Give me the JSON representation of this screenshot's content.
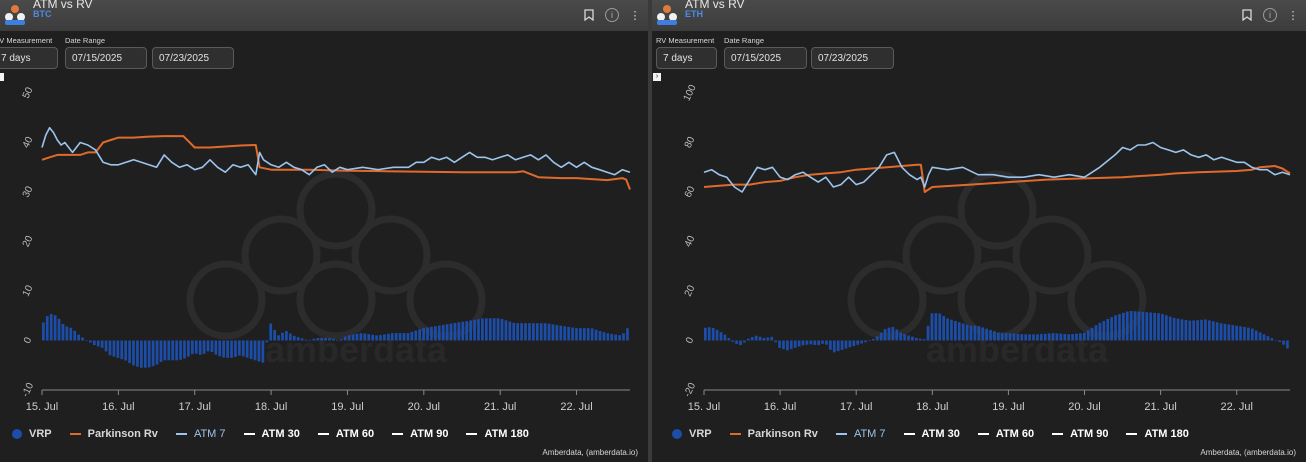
{
  "panels": [
    {
      "title": "ATM vs RV",
      "subtitle": "BTC",
      "controls": {
        "rv_label": "RV Measurement",
        "rv_value": "7 days",
        "date_label": "Date Range",
        "date_start": "07/15/2025",
        "date_end": "07/23/2025"
      },
      "watermark": "amberdata",
      "legend": [
        {
          "name": "VRP",
          "kind": "dot"
        },
        {
          "name": "Parkinson Rv",
          "kind": "line"
        },
        {
          "name": "ATM 7",
          "kind": "line"
        },
        {
          "name": "ATM 30",
          "kind": "line"
        },
        {
          "name": "ATM 60",
          "kind": "line"
        },
        {
          "name": "ATM 90",
          "kind": "line"
        },
        {
          "name": "ATM 180",
          "kind": "line"
        }
      ],
      "credit": "Amberdata, (amberdata.io)"
    },
    {
      "title": "ATM vs RV",
      "subtitle": "ETH",
      "controls": {
        "rv_label": "RV Measurement",
        "rv_value": "7 days",
        "date_label": "Date Range",
        "date_start": "07/15/2025",
        "date_end": "07/23/2025"
      },
      "watermark": "amberdata",
      "legend": [
        {
          "name": "VRP",
          "kind": "dot"
        },
        {
          "name": "Parkinson Rv",
          "kind": "line"
        },
        {
          "name": "ATM 7",
          "kind": "line"
        },
        {
          "name": "ATM 30",
          "kind": "line"
        },
        {
          "name": "ATM 60",
          "kind": "line"
        },
        {
          "name": "ATM 90",
          "kind": "line"
        },
        {
          "name": "ATM 180",
          "kind": "line"
        }
      ],
      "credit": "Amberdata, (amberdata.io)"
    }
  ],
  "colors": {
    "vrp": "#1c4da8",
    "parkinson": "#e06a2b",
    "atm7": "#9cc4ec",
    "atm_other": "#ffffff"
  },
  "chart_data": [
    {
      "type": "line",
      "asset": "BTC",
      "x_ticks": [
        "15. Jul",
        "16. Jul",
        "17. Jul",
        "18. Jul",
        "19. Jul",
        "20. Jul",
        "21. Jul",
        "22. Jul"
      ],
      "x_range_days": [
        15.0,
        22.7
      ],
      "ylim": [
        -10,
        50
      ],
      "y_ticks": [
        -10,
        0,
        10,
        20,
        30,
        40,
        50
      ],
      "grid": false,
      "legend_position": "bottom-left",
      "series": [
        {
          "name": "ATM 7",
          "x": [
            15.0,
            15.05,
            15.1,
            15.15,
            15.2,
            15.25,
            15.3,
            15.35,
            15.4,
            15.5,
            15.6,
            15.7,
            15.8,
            15.9,
            16.0,
            16.1,
            16.2,
            16.3,
            16.4,
            16.5,
            16.6,
            16.7,
            16.8,
            16.9,
            17.0,
            17.1,
            17.2,
            17.3,
            17.4,
            17.5,
            17.6,
            17.7,
            17.8,
            17.85,
            17.9,
            17.95,
            18.0,
            18.1,
            18.2,
            18.3,
            18.4,
            18.5,
            18.6,
            18.7,
            18.8,
            18.9,
            19.0,
            19.2,
            19.4,
            19.6,
            19.8,
            19.9,
            20.0,
            20.1,
            20.2,
            20.3,
            20.4,
            20.5,
            20.6,
            20.7,
            20.8,
            20.9,
            21.0,
            21.1,
            21.2,
            21.3,
            21.4,
            21.5,
            21.6,
            21.7,
            21.8,
            21.9,
            22.0,
            22.1,
            22.2,
            22.3,
            22.4,
            22.5,
            22.6,
            22.7
          ],
          "values": [
            39,
            41.5,
            43,
            42,
            40.5,
            39.5,
            40,
            39,
            38,
            40,
            39.5,
            38.5,
            36,
            35.5,
            35.5,
            36,
            36.5,
            36,
            35.5,
            35,
            37.5,
            36,
            35,
            35.5,
            34.5,
            35,
            36.5,
            35,
            34,
            35.5,
            35,
            35.5,
            33.5,
            38,
            36.5,
            36,
            35.5,
            35,
            36,
            35,
            34.5,
            33.5,
            35,
            35.5,
            34,
            35,
            34.5,
            35,
            34.5,
            35,
            35,
            36,
            36,
            37,
            36.5,
            37,
            36,
            37,
            38,
            37,
            37,
            36.5,
            37,
            37.5,
            36.5,
            37,
            37.5,
            36.5,
            37.5,
            36,
            35,
            36,
            35,
            36,
            35,
            34.5,
            34,
            33.5,
            34.5,
            34
          ]
        },
        {
          "name": "Parkinson Rv",
          "x": [
            15.0,
            15.1,
            15.2,
            15.3,
            15.4,
            15.5,
            15.6,
            15.7,
            15.8,
            15.9,
            16.0,
            16.2,
            16.4,
            16.6,
            16.8,
            16.85,
            17.0,
            17.2,
            17.4,
            17.6,
            17.8,
            17.85,
            18.0,
            18.5,
            19.0,
            19.5,
            20.0,
            20.5,
            21.0,
            21.2,
            21.3,
            21.5,
            21.8,
            22.0,
            22.2,
            22.4,
            22.6,
            22.65,
            22.7
          ],
          "values": [
            36.5,
            37,
            37.5,
            37.5,
            37.5,
            37.5,
            38,
            38,
            40,
            40.5,
            41,
            41,
            41.2,
            41.3,
            41.3,
            41.3,
            39,
            39,
            39.2,
            39.4,
            39.5,
            35,
            34.5,
            34.5,
            34.3,
            34.2,
            34.1,
            34,
            34,
            34,
            34.2,
            33,
            32.8,
            32.8,
            32.6,
            32.4,
            32.8,
            32.5,
            30.5
          ]
        },
        {
          "name": "VRP",
          "x": [
            15.0,
            15.1,
            15.2,
            15.3,
            15.4,
            15.5,
            15.6,
            15.7,
            15.8,
            15.9,
            16.0,
            16.1,
            16.2,
            16.3,
            16.4,
            16.5,
            16.6,
            16.7,
            16.8,
            16.9,
            17.0,
            17.1,
            17.2,
            17.3,
            17.4,
            17.5,
            17.6,
            17.7,
            17.8,
            17.9,
            18.0,
            18.1,
            18.2,
            18.3,
            18.4,
            18.5,
            18.6,
            18.7,
            18.8,
            18.9,
            19.0,
            19.2,
            19.4,
            19.6,
            19.8,
            20.0,
            20.2,
            20.4,
            20.6,
            20.8,
            21.0,
            21.2,
            21.4,
            21.6,
            21.8,
            22.0,
            22.2,
            22.4,
            22.6,
            22.7
          ],
          "values": [
            3,
            5.5,
            5,
            3,
            2.5,
            1,
            0,
            -1,
            -1.5,
            -3,
            -3.5,
            -4,
            -5,
            -5.5,
            -5.5,
            -5,
            -4,
            -4,
            -4,
            -3.5,
            -2.5,
            -3,
            -2,
            -3,
            -3.5,
            -3.5,
            -3,
            -3.5,
            -4,
            -4.5,
            3.5,
            1,
            2,
            1,
            0.5,
            0,
            0.5,
            0.5,
            0.5,
            0,
            1,
            1.5,
            1,
            1.5,
            1.5,
            2.5,
            3,
            3.5,
            4,
            4.5,
            4.5,
            3.5,
            3.5,
            3.5,
            3,
            2.5,
            2.5,
            1.5,
            1,
            3
          ]
        }
      ]
    },
    {
      "type": "line",
      "asset": "ETH",
      "x_ticks": [
        "15. Jul",
        "16. Jul",
        "17. Jul",
        "18. Jul",
        "19. Jul",
        "20. Jul",
        "21. Jul",
        "22. Jul"
      ],
      "x_range_days": [
        15.0,
        22.7
      ],
      "ylim": [
        -20,
        100
      ],
      "y_ticks": [
        -20,
        0,
        20,
        40,
        60,
        80,
        100
      ],
      "grid": false,
      "legend_position": "bottom-left",
      "series": [
        {
          "name": "ATM 7",
          "x": [
            15.0,
            15.1,
            15.2,
            15.3,
            15.4,
            15.5,
            15.6,
            15.7,
            15.8,
            15.9,
            16.0,
            16.1,
            16.2,
            16.3,
            16.4,
            16.5,
            16.6,
            16.7,
            16.8,
            16.9,
            17.0,
            17.1,
            17.2,
            17.3,
            17.4,
            17.5,
            17.6,
            17.7,
            17.8,
            17.85,
            17.9,
            17.95,
            18.0,
            18.2,
            18.4,
            18.6,
            18.8,
            19.0,
            19.2,
            19.4,
            19.6,
            19.8,
            20.0,
            20.2,
            20.4,
            20.5,
            20.6,
            20.7,
            20.8,
            20.9,
            21.0,
            21.1,
            21.2,
            21.3,
            21.4,
            21.5,
            21.6,
            21.7,
            21.8,
            21.9,
            22.0,
            22.1,
            22.2,
            22.3,
            22.4,
            22.5,
            22.6,
            22.7
          ],
          "values": [
            68,
            69,
            67,
            66,
            62,
            60,
            65,
            70,
            69,
            70,
            66,
            65,
            67,
            68,
            66,
            64,
            66,
            62,
            63,
            66,
            63,
            64,
            67,
            70,
            75,
            76,
            70,
            67,
            65,
            66,
            62,
            67,
            70,
            69,
            70,
            67,
            67,
            66,
            66,
            67,
            66,
            67,
            66,
            70,
            75,
            78,
            77,
            79,
            79,
            80,
            78,
            77,
            76,
            77,
            75,
            74,
            75,
            73,
            74,
            73,
            72,
            72,
            70,
            69,
            69,
            67,
            68,
            67
          ]
        },
        {
          "name": "Parkinson Rv",
          "x": [
            15.0,
            15.2,
            15.4,
            15.6,
            15.8,
            16.0,
            16.2,
            16.4,
            16.6,
            16.8,
            17.0,
            17.2,
            17.4,
            17.6,
            17.8,
            17.85,
            17.9,
            18.0,
            18.5,
            19.0,
            19.5,
            20.0,
            20.5,
            21.0,
            21.2,
            21.5,
            22.0,
            22.2,
            22.3,
            22.5,
            22.6,
            22.7
          ],
          "values": [
            62,
            62.5,
            63,
            63,
            64,
            64.5,
            66,
            67,
            67.5,
            68,
            69,
            69.5,
            70,
            70.5,
            71,
            71,
            60,
            62,
            63,
            64,
            65,
            65.5,
            66,
            67,
            67.5,
            68,
            68.5,
            69,
            70,
            70.5,
            69.5,
            67.5
          ]
        },
        {
          "name": "VRP",
          "x": [
            15.0,
            15.1,
            15.2,
            15.3,
            15.4,
            15.5,
            15.6,
            15.7,
            15.8,
            15.9,
            16.0,
            16.1,
            16.2,
            16.3,
            16.4,
            16.5,
            16.6,
            16.7,
            16.8,
            16.9,
            17.0,
            17.1,
            17.2,
            17.3,
            17.4,
            17.5,
            17.6,
            17.7,
            17.8,
            17.9,
            18.0,
            18.1,
            18.2,
            18.3,
            18.4,
            18.5,
            18.6,
            18.7,
            18.8,
            18.9,
            19.0,
            19.2,
            19.4,
            19.6,
            19.8,
            20.0,
            20.2,
            20.4,
            20.6,
            20.8,
            21.0,
            21.2,
            21.4,
            21.6,
            21.8,
            22.0,
            22.2,
            22.4,
            22.6,
            22.7
          ],
          "values": [
            5,
            5.5,
            4,
            2,
            -1,
            -2,
            1,
            2,
            1,
            1.5,
            -3,
            -4,
            -3,
            -2,
            -1.5,
            -2,
            -1,
            -5,
            -4,
            -3,
            -2,
            -1,
            0,
            2,
            5,
            5.5,
            3,
            2,
            1,
            0.5,
            11,
            11,
            9,
            8,
            7,
            6,
            6,
            5,
            4,
            3,
            3,
            2.5,
            2.5,
            3,
            2.5,
            3,
            7,
            10,
            12,
            11.5,
            11,
            9,
            8,
            8.5,
            7,
            6,
            5,
            2,
            -1,
            -4
          ]
        }
      ]
    }
  ]
}
